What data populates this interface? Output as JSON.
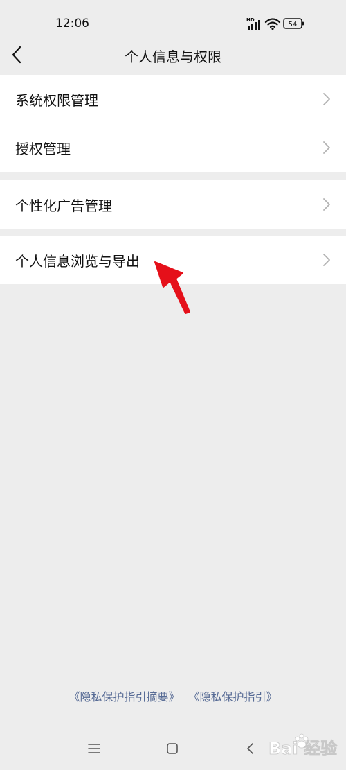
{
  "status": {
    "time": "12:06",
    "network_badge": "HD",
    "battery": "54"
  },
  "header": {
    "title": "个人信息与权限"
  },
  "groups": [
    {
      "items": [
        {
          "label": "系统权限管理"
        },
        {
          "label": "授权管理"
        }
      ]
    },
    {
      "items": [
        {
          "label": "个性化广告管理"
        }
      ]
    },
    {
      "items": [
        {
          "label": "个人信息浏览与导出"
        }
      ]
    }
  ],
  "footer": {
    "links": [
      "《隐私保护指引摘要》",
      "《隐私保护指引》"
    ]
  },
  "watermark": {
    "text": "Bai 经验"
  },
  "colors": {
    "background": "#ededed",
    "card": "#ffffff",
    "link": "#576b95",
    "annotation_arrow": "#e5101a"
  }
}
